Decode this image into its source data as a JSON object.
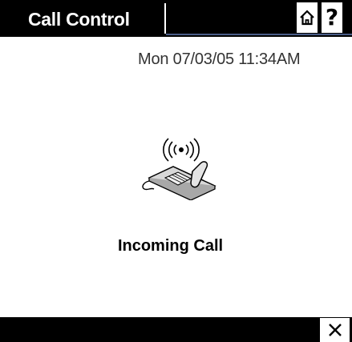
{
  "header": {
    "title": "Call Control"
  },
  "toolbar": {
    "home_icon": "home-icon",
    "help_label": "?"
  },
  "main": {
    "datetime": "Mon 07/03/05 11:34AM",
    "phone_icon": "ringing-phone-icon",
    "status": "Incoming Call"
  },
  "footer": {
    "close_icon": "close-icon"
  }
}
